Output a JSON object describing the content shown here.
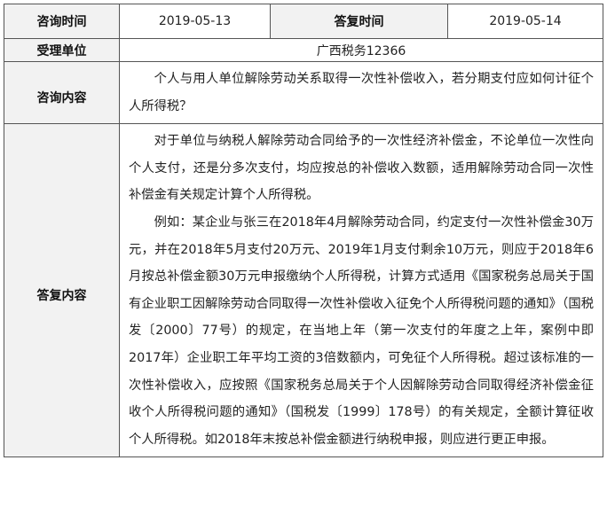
{
  "header": {
    "consult_time_label": "咨询时间",
    "consult_time_value": "2019-05-13",
    "reply_time_label": "答复时间",
    "reply_time_value": "2019-05-14"
  },
  "unit": {
    "label": "受理单位",
    "value": "广西税务12366"
  },
  "question": {
    "label": "咨询内容",
    "text": "个人与用人单位解除劳动关系取得一次性补偿收入，若分期支付应如何计征个人所得税？"
  },
  "answer": {
    "label": "答复内容",
    "paragraphs": [
      "对于单位与纳税人解除劳动合同给予的一次性经济补偿金，不论单位一次性向个人支付，还是分多次支付，均应按总的补偿收入数额，适用解除劳动合同一次性补偿金有关规定计算个人所得税。",
      "例如：某企业与张三在2018年4月解除劳动合同，约定支付一次性补偿金30万元，并在2018年5月支付20万元、2019年1月支付剩余10万元，则应于2018年6月按总补偿金额30万元申报缴纳个人所得税，计算方式适用《国家税务总局关于国有企业职工因解除劳动合同取得一次性补偿收入征免个人所得税问题的通知》（国税发〔2000〕77号）的规定，在当地上年（第一次支付的年度之上年，案例中即2017年）企业职工年平均工资的3倍数额内，可免征个人所得税。超过该标准的一次性补偿收入，应按照《国家税务总局关于个人因解除劳动合同取得经济补偿金征收个人所得税问题的通知》（国税发〔1999〕178号）的有关规定，全额计算征收个人所得税。如2018年末按总补偿金额进行纳税申报，则应进行更正申报。"
    ]
  }
}
